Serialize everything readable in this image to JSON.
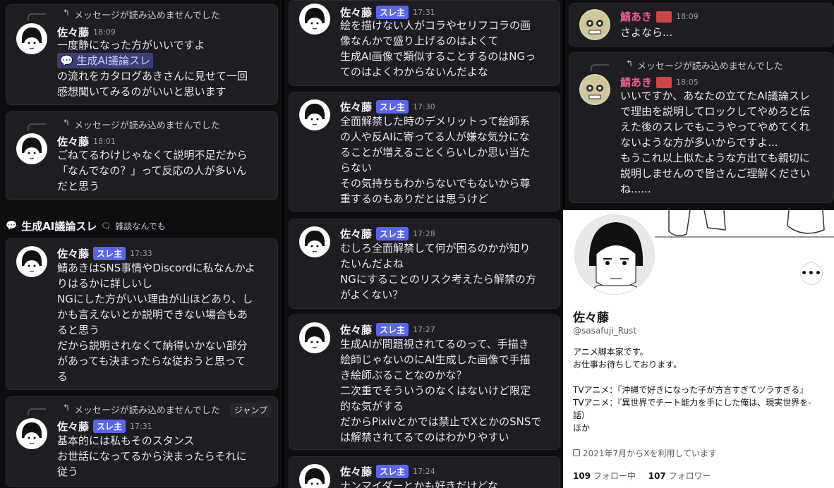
{
  "col1": {
    "msg1": {
      "reply_text": "メッセージが読み込めませんでした",
      "user": "佐々藤",
      "time": "18:09",
      "line1": "一度静になった方がいいですよ",
      "mention": "生成AI議論スレ",
      "line2": "の流れをカタログあきさんに見せて一回",
      "line3": "感想聞いてみるのがいいと思います"
    },
    "msg2": {
      "reply_text": "メッセージが読み込めませんでした",
      "user": "佐々藤",
      "time": "18:01",
      "lines": [
        "ごねてるわけじゃなくて説明不足だから",
        "「なんでなの？」って反応の人が多いん",
        "だと思う"
      ]
    },
    "thread": {
      "title": "生成AI議論スレ",
      "channel": "雑談なんでも"
    },
    "msg3": {
      "user": "佐々藤",
      "tag": "スレ主",
      "time": "17:33",
      "lines": [
        "鯖あきはSNS事情やDiscordに私なんかよ",
        "りはるかに詳しいし",
        "NGにした方がいい理由が山ほどあり、し",
        "かも言えないとか説明できない場合もあ",
        "ると思う",
        "だから説明されなくて納得いかない部分",
        "があっても決まったらな従おうと思って",
        "る"
      ]
    },
    "msg4": {
      "reply_text": "メッセージが読み込めませんでした",
      "jump": "ジャンプ",
      "user": "佐々藤",
      "tag": "スレ主",
      "time": "17:31",
      "lines": [
        "基本的には私もそのスタンス",
        "お世話になってるから決まったらそれに",
        "従う"
      ]
    }
  },
  "col2": {
    "msg1": {
      "user": "佐々藤",
      "tag": "スレ主",
      "time": "17:31",
      "lines": [
        "絵を描けない人がコラやセリフコラの画",
        "像なんかで盛り上げるのはよくて",
        "生成AI画像で類似することするのはNGっ",
        "てのはよくわからないんだよな"
      ]
    },
    "msg2": {
      "user": "佐々藤",
      "tag": "スレ主",
      "time": "17:30",
      "lines": [
        "全面解禁した時のデメリットって絵師系",
        "の人や反AIに寄ってる人が嫌な気分にな",
        "ることが増えることくらいしか思い当た",
        "らない",
        "その気持ちもわからないでもないから尊",
        "重するのもありだとは思うけど"
      ]
    },
    "msg3": {
      "user": "佐々藤",
      "tag": "スレ主",
      "time": "17:28",
      "lines": [
        "むしろ全面解禁して何が困るのかが知り",
        "たいんだよね",
        "NGにすることのリスク考えたら解禁の方",
        "がよくない？"
      ]
    },
    "msg4": {
      "user": "佐々藤",
      "tag": "スレ主",
      "time": "17:27",
      "lines": [
        "生成AIが問題視されてるのって、手描き",
        "絵師じゃないのにAI生成した画像で手描",
        "き絵師ぶることなのかな？",
        "二次重でそういうのなくはないけど限定",
        "的な気がする",
        "だからPixivとかでは禁止でXとかのSNSで",
        "は解禁されてるてのはわかりやすい"
      ]
    },
    "msg5": {
      "user": "佐々藤",
      "tag": "スレ主",
      "time": "17:24",
      "lines": [
        "ナンマイダーとかも好きだけどな"
      ]
    }
  },
  "col3": {
    "msg1": {
      "user": "鯖あき",
      "time": "18:09",
      "lines": [
        "さよなら..."
      ]
    },
    "msg2": {
      "reply_text": "メッセージが読み込めませんでした",
      "user": "鯖あき",
      "time": "18:05",
      "lines": [
        "いいですか、あなたの立てたAI議論スレ",
        "で理由を説明してロックしてやめろと伝",
        "えた後のスレでもこうやってやめてくれ",
        "ないような方が多いからですよ...",
        "もうこれ以上似たような方出ても親切に",
        "説明しませんので皆さんご理解ください",
        "ね......"
      ]
    }
  },
  "profile": {
    "name": "佐々藤",
    "handle": "@sasafuji_Rust",
    "bio": [
      "アニメ脚本家です。",
      "お仕事お待ちしております。",
      "",
      "TVアニメ：『沖縄で好きになった子が方言すぎてツラすぎる』",
      "TVアニメ：『異世界でチート能力を手にした俺は、現実世界を-",
      "話）",
      "ほか"
    ],
    "joined": "2021年7月からXを利用しています",
    "following_count": "109",
    "following_label": "フォロー中",
    "followers_count": "107",
    "followers_label": "フォロワー",
    "more_icon": "more-icon"
  }
}
